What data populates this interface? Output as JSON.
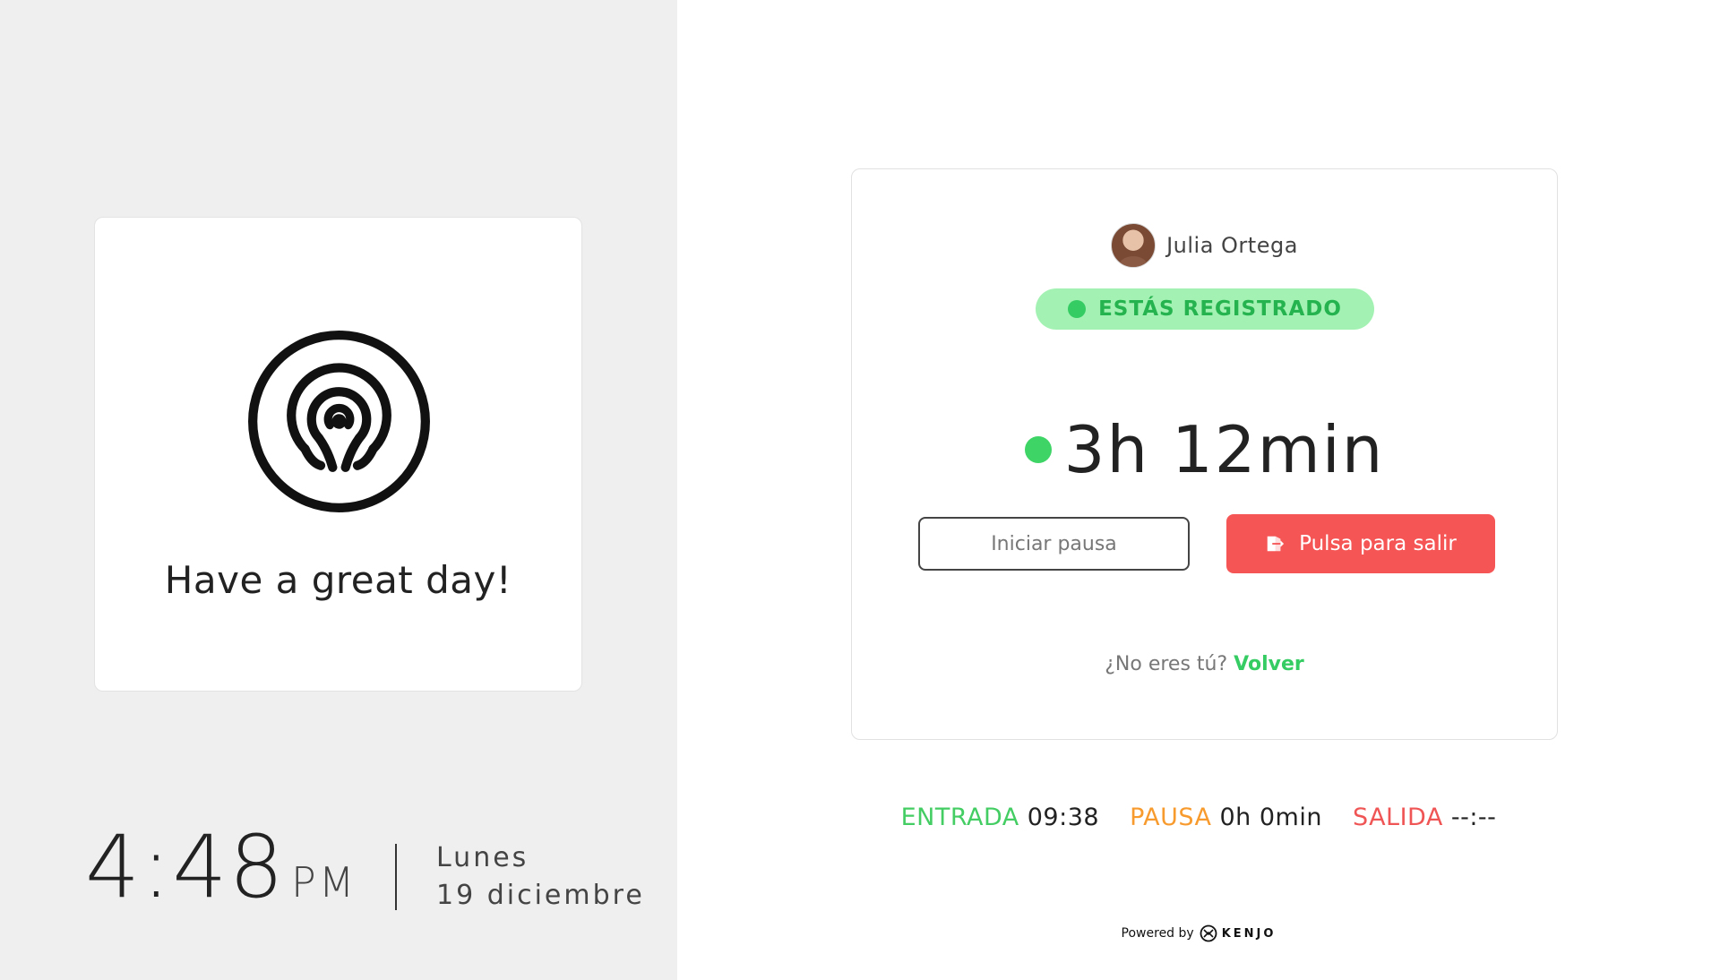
{
  "left": {
    "greeting": "Have a great day!",
    "logo_icon": "labyrinth-logo-icon",
    "clock": {
      "time": "4:48",
      "ampm": "PM",
      "day": "Lunes",
      "date": "19 diciembre"
    }
  },
  "status": {
    "user_name": "Julia Ortega",
    "badge": "ESTÁS REGISTRADO",
    "worked_time": "3h 12min",
    "pause_button": "Iniciar pausa",
    "exit_button": "Pulsa para salir",
    "not_you_text": "¿No eres tú?",
    "back_link": "Volver"
  },
  "summary": {
    "entrada_label": "ENTRADA",
    "entrada_value": "09:38",
    "pausa_label": "PAUSA",
    "pausa_value": "0h 0min",
    "salida_label": "SALIDA",
    "salida_value": "--:--"
  },
  "footer": {
    "powered_by": "Powered by",
    "brand": "KENJO"
  },
  "colors": {
    "left_background": "#efefef",
    "green": "#35cc63",
    "badge_background": "#a3f2b3",
    "red": "#f65555",
    "orange": "#f89b2e"
  }
}
